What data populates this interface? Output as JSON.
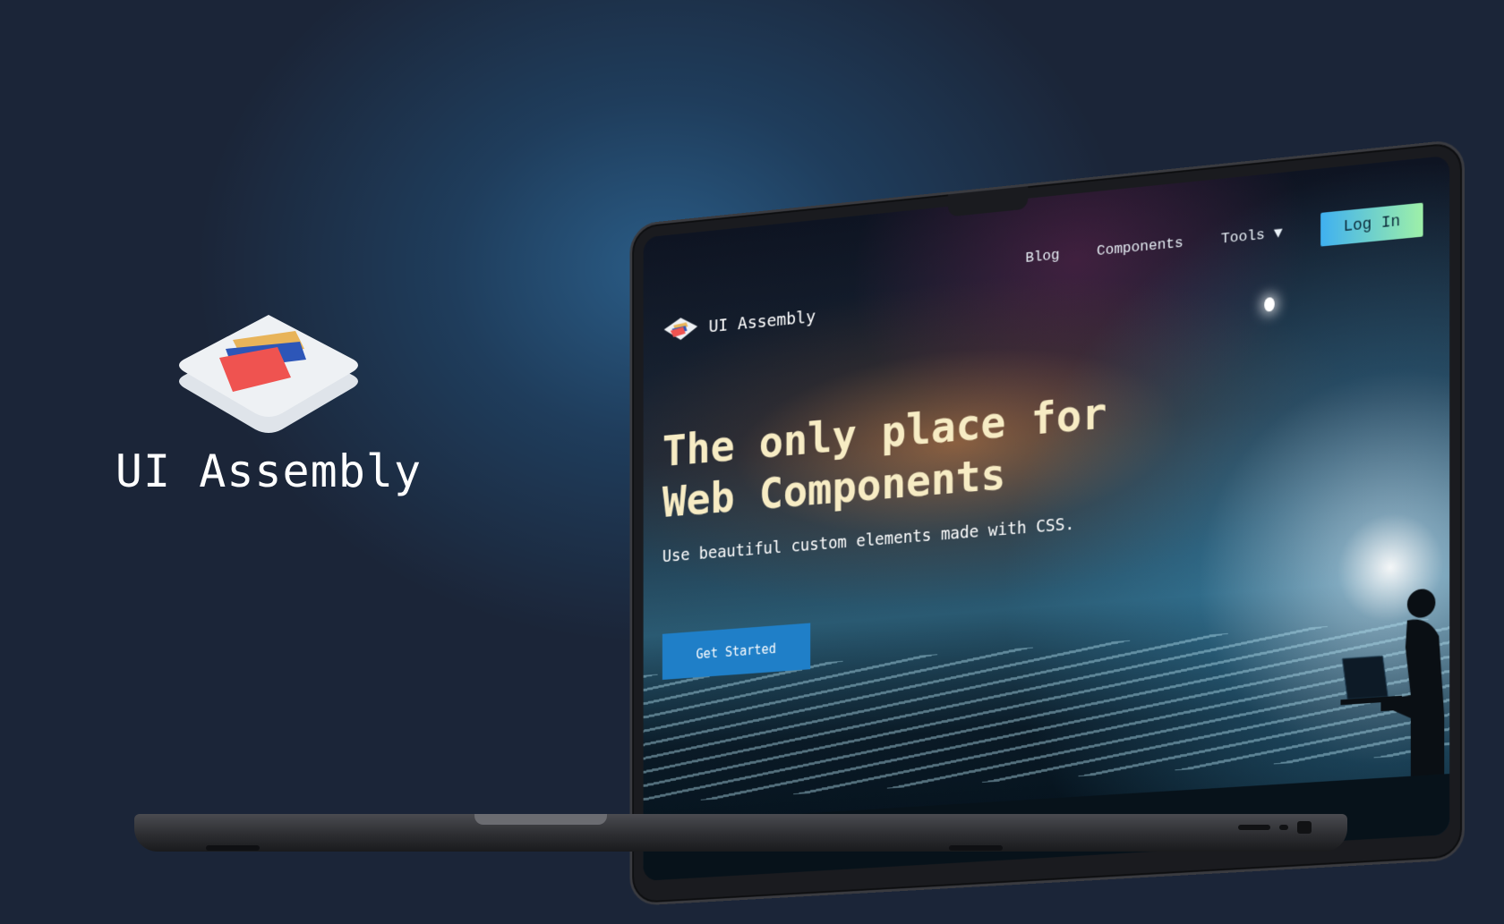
{
  "brand": {
    "name": "UI Assembly",
    "logo_icon": "stacked-cards-icon"
  },
  "site": {
    "logo_name": "UI Assembly",
    "nav": [
      {
        "label": "Blog"
      },
      {
        "label": "Components"
      },
      {
        "label": "Tools ▼"
      }
    ],
    "login_label": "Log In",
    "hero": {
      "title_line1": "The only place for",
      "title_line2": "Web Components",
      "subtitle": "Use beautiful custom elements made with CSS.",
      "cta_label": "Get Started"
    }
  },
  "colors": {
    "background": "#1b2538",
    "accent_blue": "#1f7fc8",
    "hero_title": "#f7ecc4",
    "login_gradient_start": "#3fb0f0",
    "login_gradient_end": "#9ef0a8",
    "card_red": "#ef5350",
    "card_blue": "#2d56b8",
    "card_yellow": "#e8b45a"
  }
}
